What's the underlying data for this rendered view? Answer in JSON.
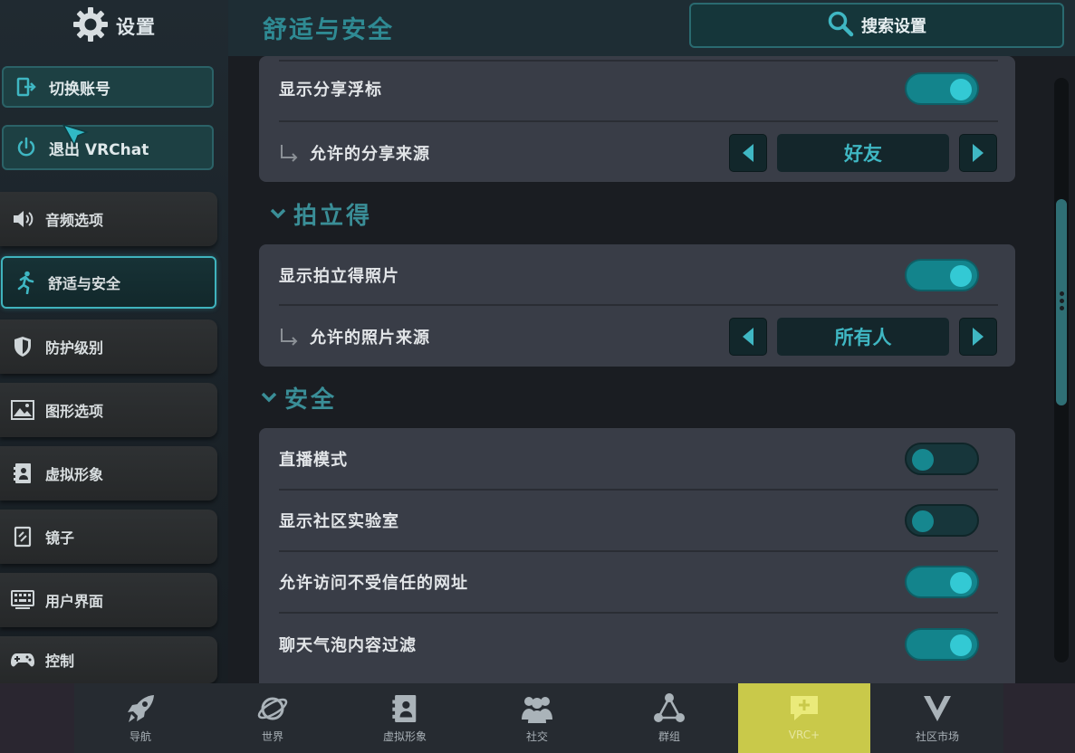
{
  "sidebar": {
    "title": "设置",
    "account_buttons": [
      {
        "label": "切换账号",
        "icon": "switch-account-icon"
      },
      {
        "label": "退出 VRChat",
        "icon": "power-icon"
      }
    ],
    "items": [
      {
        "label": "音频选项",
        "icon": "speaker-icon"
      },
      {
        "label": "舒适与安全",
        "icon": "running-figure-icon",
        "active": true
      },
      {
        "label": "防护级别",
        "icon": "shield-icon"
      },
      {
        "label": "图形选项",
        "icon": "image-icon"
      },
      {
        "label": "虚拟形象",
        "icon": "avatar-book-icon"
      },
      {
        "label": "镜子",
        "icon": "mirror-icon"
      },
      {
        "label": "用户界面",
        "icon": "keyboard-icon"
      },
      {
        "label": "控制",
        "icon": "gamepad-icon"
      }
    ]
  },
  "header": {
    "title": "舒适与安全",
    "search_label": "搜索设置"
  },
  "sections": {
    "share": {
      "rows": [
        {
          "label": "显示分享浮标",
          "toggle": "on"
        },
        {
          "label": "允许的分享来源",
          "value": "好友"
        }
      ]
    },
    "polaroid": {
      "title": "拍立得",
      "rows": [
        {
          "label": "显示拍立得照片",
          "toggle": "on"
        },
        {
          "label": "允许的照片来源",
          "value": "所有人"
        }
      ]
    },
    "safety": {
      "title": "安全",
      "rows": [
        {
          "label": "直播模式",
          "toggle": "off"
        },
        {
          "label": "显示社区实验室",
          "toggle": "off"
        },
        {
          "label": "允许访问不受信任的网址",
          "toggle": "on"
        },
        {
          "label": "聊天气泡内容过滤",
          "toggle": "on"
        }
      ]
    }
  },
  "dock": {
    "items": [
      {
        "label": "导航",
        "icon": "rocket-icon"
      },
      {
        "label": "世界",
        "icon": "planet-icon"
      },
      {
        "label": "虚拟形象",
        "icon": "avatar-book-icon"
      },
      {
        "label": "社交",
        "icon": "people-icon"
      },
      {
        "label": "群组",
        "icon": "group-icon"
      },
      {
        "label": "VRC+",
        "icon": "vrcplus-chat-icon",
        "highlight": true
      },
      {
        "label": "社区市场",
        "icon": "v-logo-icon"
      }
    ]
  },
  "colors": {
    "accent": "#3fb7c3",
    "toggle_on": "#13848c",
    "vrcplus": "#c9c94a"
  }
}
